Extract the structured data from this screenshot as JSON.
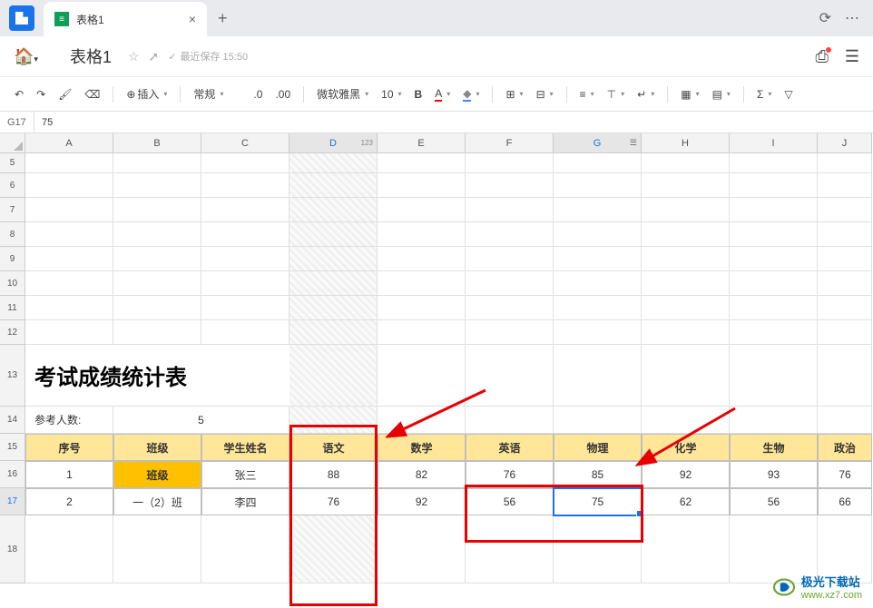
{
  "tab": {
    "title": "表格1",
    "close": "×",
    "add": "+"
  },
  "titlebar": {
    "doc": "表格1",
    "save_status": "最近保存 15:50"
  },
  "toolbar": {
    "insert": "插入",
    "format_general": "常规",
    "decimal": ".0",
    "decimal2": ".00",
    "font": "微软雅黑",
    "font_size": "10",
    "bold": "B",
    "underline": "A",
    "fill": "◆"
  },
  "formula": {
    "ref": "G17",
    "value": "75"
  },
  "columns": [
    "A",
    "B",
    "C",
    "D",
    "E",
    "F",
    "G",
    "H",
    "I",
    "J"
  ],
  "col_d_hint": "123",
  "chart_data": {
    "type": "table",
    "title": "考试成绩统计表",
    "meta": {
      "参考人数": 5
    },
    "columns": [
      "序号",
      "班级",
      "学生姓名",
      "语文",
      "数学",
      "英语",
      "物理",
      "化学",
      "生物",
      "政治"
    ],
    "rows": [
      {
        "序号": 1,
        "班级": "班级",
        "学生姓名": "张三",
        "语文": 88,
        "数学": 82,
        "英语": 76,
        "物理": 85,
        "化学": 92,
        "生物": 93,
        "政治": 76
      },
      {
        "序号": 2,
        "班级": "一（2）班",
        "学生姓名": "李四",
        "语文": 76,
        "数学": 92,
        "英语": 56,
        "物理": 75,
        "化学": 62,
        "生物": 56,
        "政治": 66
      }
    ]
  },
  "labels": {
    "exam_count": "参考人数:",
    "count_val": "5"
  },
  "watermark": {
    "name": "极光下载站",
    "url": "www.xz7.com"
  }
}
